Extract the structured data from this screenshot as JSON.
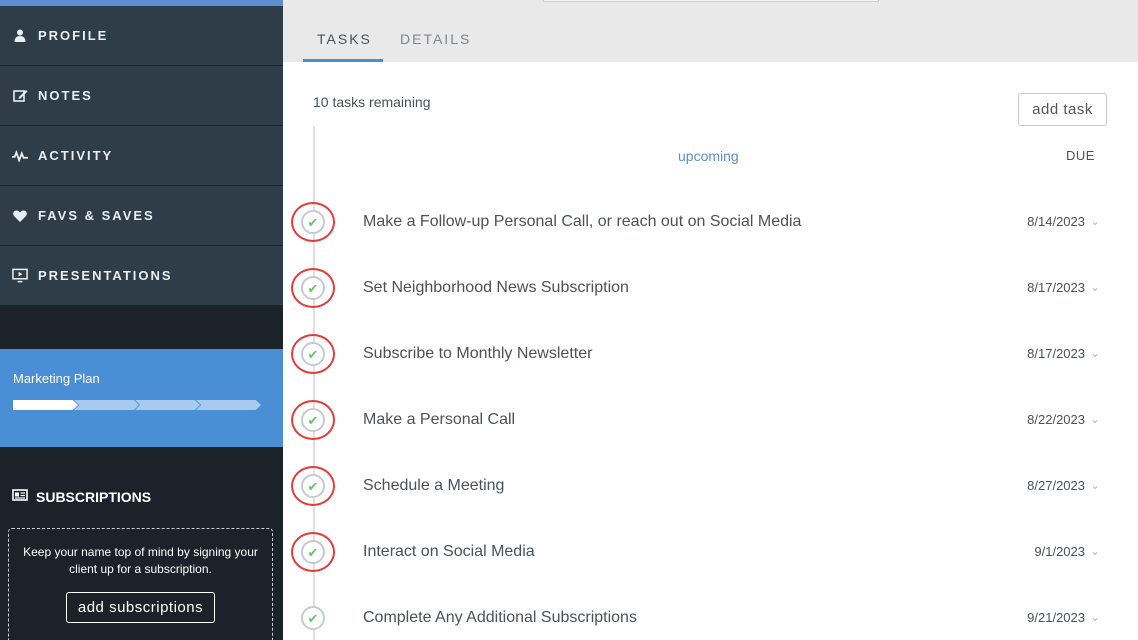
{
  "sidebar": {
    "nav": [
      {
        "label": "PROFILE",
        "icon": "user-icon"
      },
      {
        "label": "NOTES",
        "icon": "edit-icon"
      },
      {
        "label": "ACTIVITY",
        "icon": "activity-icon"
      },
      {
        "label": "FAVS & SAVES",
        "icon": "heart-icon"
      },
      {
        "label": "PRESENTATIONS",
        "icon": "presentation-icon"
      }
    ],
    "marketing_plan": {
      "title": "Marketing Plan",
      "progress_steps_total": 5,
      "progress_steps_done": 1
    },
    "subscriptions": {
      "title": "SUBSCRIPTIONS",
      "icon": "newspaper-icon",
      "description": "Keep your name top of mind by signing your client up for a subscription.",
      "button_label": "add subscriptions"
    }
  },
  "tabs": [
    {
      "label": "TASKS",
      "active": true
    },
    {
      "label": "DETAILS",
      "active": false
    }
  ],
  "tasks_panel": {
    "remaining_text": "10 tasks remaining",
    "add_button_label": "add task",
    "group_label": "upcoming",
    "due_header": "DUE",
    "tasks": [
      {
        "title": "Make a Follow-up Personal Call, or reach out on Social Media",
        "due": "8/14/2023",
        "highlighted": true
      },
      {
        "title": "Set Neighborhood News Subscription",
        "due": "8/17/2023",
        "highlighted": true
      },
      {
        "title": "Subscribe to Monthly Newsletter",
        "due": "8/17/2023",
        "highlighted": true
      },
      {
        "title": "Make a Personal Call",
        "due": "8/22/2023",
        "highlighted": true
      },
      {
        "title": "Schedule a Meeting",
        "due": "8/27/2023",
        "highlighted": true
      },
      {
        "title": "Interact on Social Media",
        "due": "9/1/2023",
        "highlighted": true
      },
      {
        "title": "Complete Any Additional Subscriptions",
        "due": "9/21/2023",
        "highlighted": false
      }
    ]
  },
  "colors": {
    "accent": "#4a8fd6",
    "sidebar_bg": "#1b2229",
    "nav_bg": "#2f3d49",
    "highlight_ring": "#e53b3b",
    "check_green": "#6cc26c"
  }
}
